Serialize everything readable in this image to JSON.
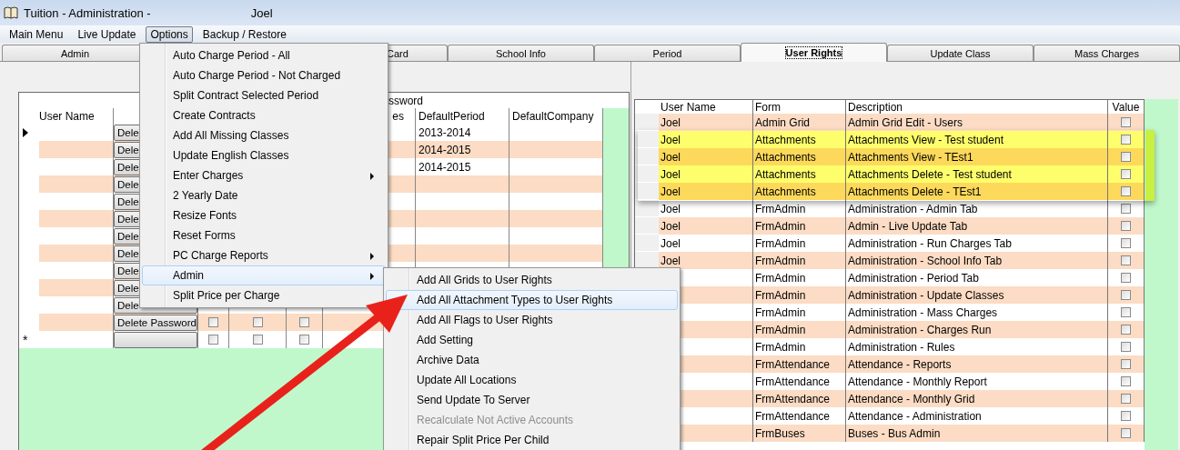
{
  "window": {
    "title": "Tuition - Administration -",
    "user": "Joel"
  },
  "menu_bar": [
    {
      "label": "Main Menu",
      "selected": false
    },
    {
      "label": "Live Update",
      "selected": false
    },
    {
      "label": "Options",
      "selected": true
    },
    {
      "label": "Backup / Restore",
      "selected": false
    }
  ],
  "tabs": [
    {
      "label": "Admin",
      "selected": false
    },
    {
      "label": "Card",
      "selected": false
    },
    {
      "label": "School Info",
      "selected": false
    },
    {
      "label": "Period",
      "selected": false
    },
    {
      "label": "User Rights",
      "selected": true
    },
    {
      "label": "Update Class",
      "selected": false
    },
    {
      "label": "Mass Charges",
      "selected": false
    }
  ],
  "users_grid": {
    "group_header": "ssword",
    "columns": {
      "user_name": "User Name",
      "column_6": "es",
      "default_period": "DefaultPeriod",
      "default_company": "DefaultCompany"
    },
    "rows": [
      {
        "current": true,
        "button": "Dele",
        "default_period": "2013-2014"
      },
      {
        "current": false,
        "button": "Dele",
        "default_period": "2014-2015"
      },
      {
        "current": false,
        "button": "Dele",
        "default_period": "2014-2015"
      },
      {
        "current": false,
        "button": "Dele"
      },
      {
        "current": false,
        "button": "Dele"
      },
      {
        "current": false,
        "button": "Dele"
      },
      {
        "current": false,
        "button": "Dele"
      },
      {
        "current": false,
        "button": "Dele"
      },
      {
        "current": false,
        "button": "Dele"
      },
      {
        "current": false,
        "button": "Dele"
      },
      {
        "current": false,
        "button": "Dele"
      },
      {
        "current": false,
        "button": "Delete Password",
        "checks": [
          false,
          false,
          false
        ]
      }
    ],
    "new_row": {
      "marker": "*",
      "checks": [
        false,
        false,
        false
      ]
    }
  },
  "rights_grid": {
    "columns": [
      "User Name",
      "Form",
      "Description",
      "Value"
    ],
    "rows": [
      {
        "user": "Joel",
        "form": "Admin Grid",
        "description": "Admin Grid Edit - Users",
        "highlighted": false,
        "checked": false
      },
      {
        "user": "Joel",
        "form": "Attachments",
        "description": "Attachments View - Test student",
        "highlighted": true,
        "checked": false
      },
      {
        "user": "Joel",
        "form": "Attachments",
        "description": "Attachments View - TEst1",
        "highlighted": true,
        "checked": false
      },
      {
        "user": "Joel",
        "form": "Attachments",
        "description": "Attachments Delete - Test student",
        "highlighted": true,
        "checked": false
      },
      {
        "user": "Joel",
        "form": "Attachments",
        "description": "Attachments Delete - TEst1",
        "highlighted": true,
        "checked": false
      },
      {
        "user": "Joel",
        "form": "FrmAdmin",
        "description": "Administration - Admin Tab",
        "highlighted": false,
        "checked": false
      },
      {
        "user": "Joel",
        "form": "FrmAdmin",
        "description": "Admin - Live Update Tab",
        "highlighted": false,
        "checked": false
      },
      {
        "user": "Joel",
        "form": "FrmAdmin",
        "description": "Administration - Run Charges Tab",
        "highlighted": false,
        "checked": false
      },
      {
        "user": "Joel",
        "form": "FrmAdmin",
        "description": "Administration - School Info Tab",
        "highlighted": false,
        "checked": false
      },
      {
        "form": "FrmAdmin",
        "description": "Administration - Period Tab",
        "highlighted": false,
        "checked": false
      },
      {
        "form": "FrmAdmin",
        "description": "Administration - Update Classes",
        "highlighted": false,
        "checked": false
      },
      {
        "form": "FrmAdmin",
        "description": "Administration - Mass Charges",
        "highlighted": false,
        "checked": false
      },
      {
        "form": "FrmAdmin",
        "description": "Administration - Charges Run",
        "highlighted": false,
        "checked": false
      },
      {
        "form": "FrmAdmin",
        "description": "Administration - Rules",
        "highlighted": false,
        "checked": false
      },
      {
        "form": "FrmAttendance",
        "description": "Attendance - Reports",
        "highlighted": false,
        "checked": false
      },
      {
        "form": "FrmAttendance",
        "description": "Attendance - Monthly Report",
        "highlighted": false,
        "checked": false
      },
      {
        "form": "FrmAttendance",
        "description": "Attendance - Monthly Grid",
        "highlighted": false,
        "checked": false
      },
      {
        "form": "FrmAttendance",
        "description": "Attendance - Administration",
        "highlighted": false,
        "checked": false
      },
      {
        "form": "FrmBuses",
        "description": "Buses - Bus Admin",
        "highlighted": false,
        "checked": false
      }
    ]
  },
  "options_menu": [
    {
      "label": "Auto Charge Period - All",
      "submenu": false,
      "selected": false
    },
    {
      "label": "Auto Charge Period - Not Charged",
      "submenu": false,
      "selected": false
    },
    {
      "label": "Split Contract Selected Period",
      "submenu": false,
      "selected": false
    },
    {
      "label": "Create Contracts",
      "submenu": false,
      "selected": false
    },
    {
      "label": "Add All Missing Classes",
      "submenu": false,
      "selected": false
    },
    {
      "label": "Update English Classes",
      "submenu": false,
      "selected": false
    },
    {
      "label": "Enter Charges",
      "submenu": true,
      "selected": false
    },
    {
      "label": "2 Yearly Date",
      "submenu": false,
      "selected": false
    },
    {
      "label": "Resize Fonts",
      "submenu": false,
      "selected": false
    },
    {
      "label": "Reset Forms",
      "submenu": false,
      "selected": false
    },
    {
      "label": "PC Charge Reports",
      "submenu": true,
      "selected": false
    },
    {
      "label": "Admin",
      "submenu": true,
      "selected": true
    },
    {
      "label": "Split Price per Charge",
      "submenu": false,
      "selected": false
    }
  ],
  "admin_submenu": [
    {
      "label": "Add All Grids to User Rights",
      "selected": false,
      "disabled": false
    },
    {
      "label": "Add All Attachment Types to User Rights",
      "selected": true,
      "disabled": false
    },
    {
      "label": "Add All Flags to User Rights",
      "selected": false,
      "disabled": false
    },
    {
      "label": "Add Setting",
      "selected": false,
      "disabled": false
    },
    {
      "label": "Archive Data",
      "selected": false,
      "disabled": false
    },
    {
      "label": "Update All Locations",
      "selected": false,
      "disabled": false
    },
    {
      "label": "Send Update To Server",
      "selected": false,
      "disabled": false
    },
    {
      "label": "Recalculate Not Active Accounts",
      "selected": false,
      "disabled": true
    },
    {
      "label": "Repair Split Price Per Child",
      "selected": false,
      "disabled": false
    }
  ]
}
